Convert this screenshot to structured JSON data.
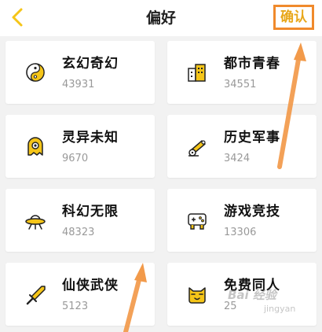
{
  "header": {
    "title": "偏好",
    "confirm_label": "确认"
  },
  "categories": [
    {
      "name": "玄幻奇幻",
      "count": "43931",
      "icon": "yin-yang-icon"
    },
    {
      "name": "都市青春",
      "count": "34551",
      "icon": "city-building-icon"
    },
    {
      "name": "灵异未知",
      "count": "9670",
      "icon": "ghost-icon"
    },
    {
      "name": "历史军事",
      "count": "3424",
      "icon": "cannon-icon"
    },
    {
      "name": "科幻无限",
      "count": "48323",
      "icon": "ufo-icon"
    },
    {
      "name": "游戏竞技",
      "count": "13306",
      "icon": "gamepad-icon"
    },
    {
      "name": "仙侠武侠",
      "count": "5123",
      "icon": "sword-icon"
    },
    {
      "name": "免费同人",
      "count": "25",
      "icon": "cat-face-icon"
    }
  ],
  "watermark": {
    "text": "Bai 经验",
    "sub": "jingyan"
  },
  "colors": {
    "accent": "#f5c518",
    "arrow": "#f29a4a",
    "highlight_border": "#f08a2c"
  }
}
